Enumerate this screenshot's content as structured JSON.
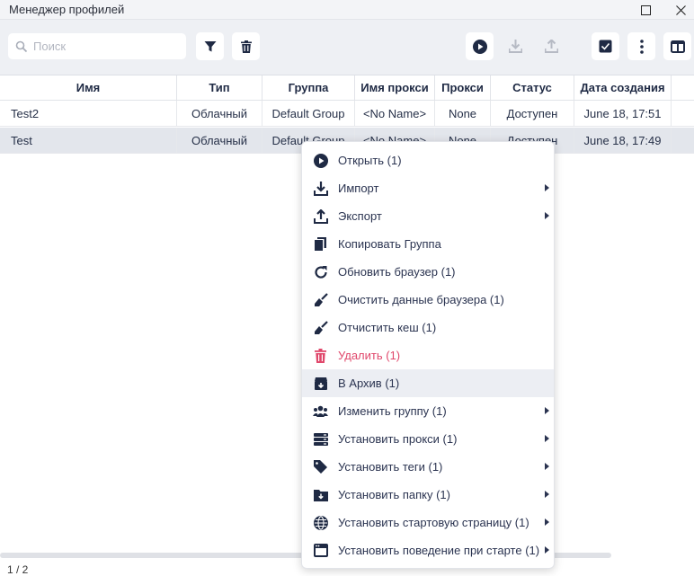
{
  "window": {
    "title": "Менеджер профилей"
  },
  "toolbar": {
    "search_placeholder": "Поиск"
  },
  "table": {
    "columns": [
      "Имя",
      "Тип",
      "Группа",
      "Имя прокси",
      "Прокси",
      "Статус",
      "Дата создания"
    ],
    "rows": [
      {
        "name": "Test2",
        "type": "Облачный",
        "group": "Default Group",
        "proxy_name": "<No Name>",
        "proxy": "None",
        "status": "Доступен",
        "created": "June 18, 17:51"
      },
      {
        "name": "Test",
        "type": "Облачный",
        "group": "Default Group",
        "proxy_name": "<No Name>",
        "proxy": "None",
        "status": "Доступен",
        "created": "June 18, 17:49"
      }
    ]
  },
  "pager": {
    "text": "1 / 2"
  },
  "context_menu": {
    "items": [
      {
        "label": "Открыть (1)",
        "icon": "play-circle-icon",
        "submenu": false
      },
      {
        "label": "Импорт",
        "icon": "download-icon",
        "submenu": true
      },
      {
        "label": "Экспорт",
        "icon": "upload-icon",
        "submenu": true
      },
      {
        "label": "Копировать Группа",
        "icon": "copy-icon",
        "submenu": false
      },
      {
        "label": "Обновить браузер (1)",
        "icon": "refresh-icon",
        "submenu": false
      },
      {
        "label": "Очистить данные браузера (1)",
        "icon": "broom-icon",
        "submenu": false
      },
      {
        "label": "Отчистить кеш (1)",
        "icon": "broom-icon",
        "submenu": false
      },
      {
        "label": "Удалить (1)",
        "icon": "trash-icon",
        "submenu": false,
        "danger": true
      },
      {
        "label": "В Архив (1)",
        "icon": "archive-icon",
        "submenu": false,
        "highlighted": true
      },
      {
        "label": "Изменить группу (1)",
        "icon": "users-icon",
        "submenu": true
      },
      {
        "label": "Установить прокси (1)",
        "icon": "server-icon",
        "submenu": true
      },
      {
        "label": "Установить теги (1)",
        "icon": "tag-icon",
        "submenu": true
      },
      {
        "label": "Установить папку (1)",
        "icon": "folder-icon",
        "submenu": true
      },
      {
        "label": "Установить стартовую страницу (1)",
        "icon": "globe-icon",
        "submenu": true
      },
      {
        "label": "Установить поведение при старте (1)",
        "icon": "browser-window-icon",
        "submenu": true
      }
    ]
  },
  "colors": {
    "accent_dark": "#1f2a44",
    "danger": "#e0476b",
    "selected_row": "#e3e6ec",
    "toolbar_bg": "#eef0f4"
  }
}
